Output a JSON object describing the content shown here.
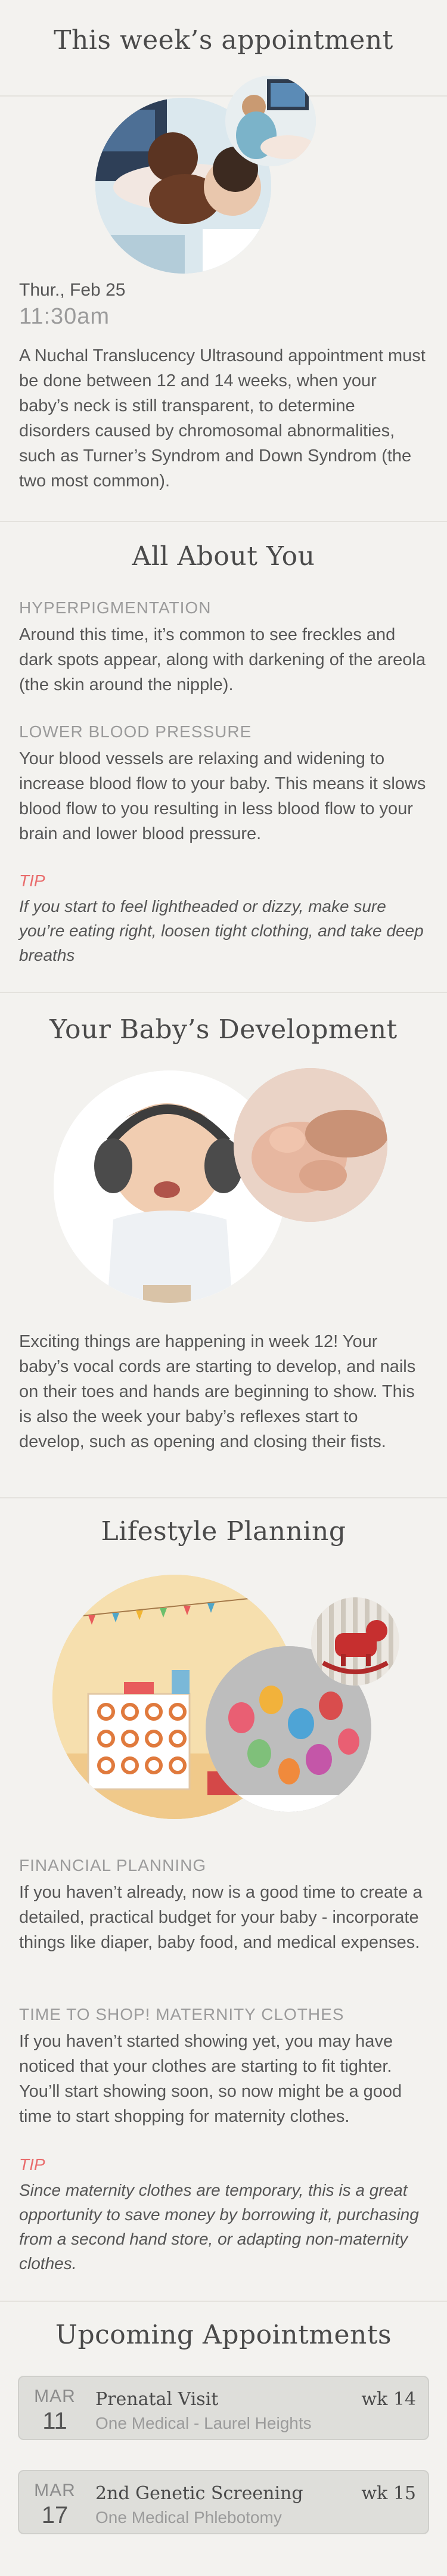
{
  "appointment_section": {
    "title": "This week’s appointment",
    "date": "Thur., Feb 25",
    "time": "11:30am",
    "description": "A Nuchal Translucency Ultrasound appointment must be done between 12 and 14 weeks, when your baby’s neck is still transparent, to determine disorders caused by chromosomal abnormalities, such as Turner’s Syndrom and Down Syndrom (the two most common)."
  },
  "about_you": {
    "title": "All About You",
    "topics": [
      {
        "heading": "HYPERPIGMENTATION",
        "text": "Around this time, it’s common to see freckles and dark spots appear, along with darkening of the areola (the skin around the nipple)."
      },
      {
        "heading": "LOWER BLOOD PRESSURE",
        "text": "Your blood vessels are relaxing and widening to increase blood flow to your baby. This means it slows blood flow to you resulting in less blood flow to your brain and lower blood pressure."
      }
    ],
    "tip_label": "TIP",
    "tip_text": "If you start to feel lightheaded or dizzy, make sure you’re eating right, loosen tight clothing, and take deep breaths"
  },
  "baby_development": {
    "title": "Your Baby’s Development",
    "text": "Exciting things are happening in week 12! Your baby’s vocal cords are starting to develop, and nails on their toes and hands are beginning to show. This is also the week your baby’s reflexes start to develop, such as opening and closing their fists."
  },
  "lifestyle": {
    "title": "Lifestyle Planning",
    "topics": [
      {
        "heading": "FINANCIAL PLANNING",
        "text": "If you haven’t already, now is a good time to create a detailed, practical budget for your baby - incorporate things like diaper, baby food, and medical expenses."
      },
      {
        "heading": "TIME TO SHOP! MATERNITY CLOTHES",
        "text": "If you haven’t started showing yet, you may have noticed that your clothes are starting to fit tighter. You’ll start showing soon, so now might be a good time to start shopping for maternity clothes."
      }
    ],
    "tip_label": "TIP",
    "tip_text": "Since maternity clothes are temporary, this is a great opportunity to save money by borrowing it, purchasing from a second hand store, or adapting non-maternity clothes."
  },
  "upcoming": {
    "title": "Upcoming Appointments",
    "items": [
      {
        "month": "MAR",
        "day": "11",
        "title": "Prenatal Visit",
        "location": "One Medical - Laurel Heights",
        "week": "wk 14"
      },
      {
        "month": "MAR",
        "day": "17",
        "title": "2nd Genetic Screening",
        "location": "One Medical Phlebotomy",
        "week": "wk 15"
      }
    ]
  },
  "colors": {
    "background": "#f3f2ef",
    "tip": "#e96c6c",
    "card": "#dededa"
  }
}
